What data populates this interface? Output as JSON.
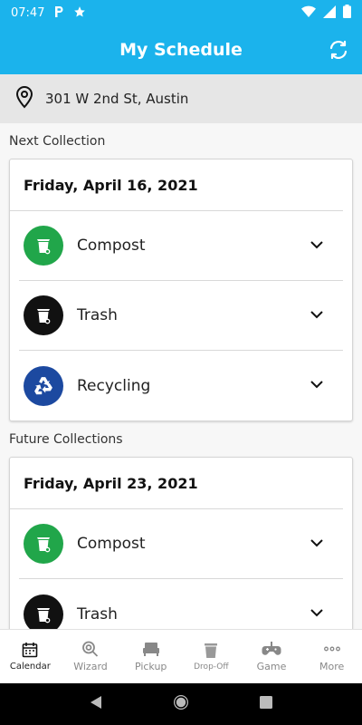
{
  "status_bar": {
    "time": "07:47",
    "icons": [
      "p-notification-icon",
      "star-icon",
      "wifi-icon",
      "signal-icon",
      "battery-icon"
    ]
  },
  "app_bar": {
    "title": "My Schedule",
    "refresh_icon": "refresh-icon"
  },
  "address": {
    "icon": "location-pin-icon",
    "text": "301 W 2nd St, Austin"
  },
  "next_collection": {
    "heading": "Next Collection",
    "date": "Friday, April 16, 2021",
    "items": [
      {
        "label": "Compost",
        "icon": "compost-bin-icon",
        "color": "#21a64a"
      },
      {
        "label": "Trash",
        "icon": "trash-bin-icon",
        "color": "#111111"
      },
      {
        "label": "Recycling",
        "icon": "recycling-icon",
        "color": "#1c49a0"
      }
    ]
  },
  "future_collections": {
    "heading": "Future Collections",
    "date": "Friday, April 23, 2021",
    "items": [
      {
        "label": "Compost",
        "icon": "compost-bin-icon",
        "color": "#21a64a"
      },
      {
        "label": "Trash",
        "icon": "trash-bin-icon",
        "color": "#111111"
      }
    ]
  },
  "bottom_nav": {
    "items": [
      {
        "label": "Calendar",
        "icon": "calendar-icon",
        "active": true
      },
      {
        "label": "Wizard",
        "icon": "search-icon",
        "active": false
      },
      {
        "label": "Pickup",
        "icon": "couch-icon",
        "active": false
      },
      {
        "label": "Drop-Off",
        "icon": "bin-drop-icon",
        "active": false
      },
      {
        "label": "Game",
        "icon": "gamepad-icon",
        "active": false
      },
      {
        "label": "More",
        "icon": "more-dots-icon",
        "active": false
      }
    ]
  },
  "colors": {
    "primary": "#1bb3ec",
    "address_bg": "#e6e6e6",
    "content_bg": "#f7f7f7"
  }
}
